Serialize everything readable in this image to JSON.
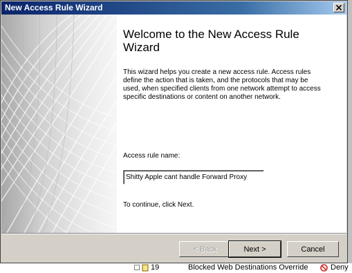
{
  "window": {
    "title": "New Access Rule Wizard"
  },
  "wizard": {
    "heading": "Welcome to the New Access Rule Wizard",
    "intro": "This wizard helps you create a new access rule. Access rules define the action that is taken, and the protocols that may be used, when specified clients from one network attempt to access specific destinations or content on another network.",
    "name_label": "Access rule name:",
    "name_value": "Shitty Apple cant handle Forward Proxy",
    "continue_text": "To continue, click Next."
  },
  "buttons": {
    "back": "< Back",
    "next": "Next >",
    "cancel": "Cancel"
  },
  "background_row": {
    "order": "19",
    "name": "Blocked Web Destinations Override",
    "action": "Deny"
  },
  "icons": {
    "close": "close-icon",
    "expand": "expand-icon",
    "rule": "rule-icon",
    "deny": "deny-icon"
  }
}
